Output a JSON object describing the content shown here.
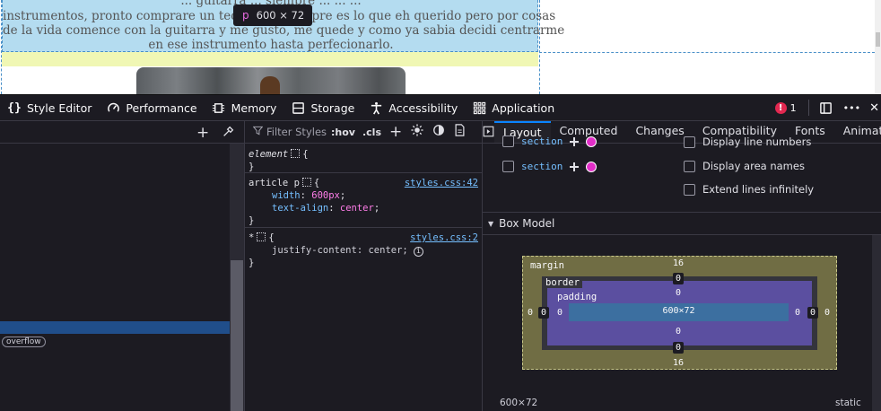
{
  "viewport": {
    "paragraph_lines": [
      "... guitarra ... siempre ... ... ...",
      "instrumentos, pronto comprare un teclado ... siempre es lo que eh querido pero por cosas",
      "de la vida comence con la guitarra y me gusto, me quede y como ya sabia decidi centrarme",
      "en ese instrumento hasta perfecionarlo."
    ],
    "tooltip": {
      "tag": "p",
      "dims": "600 × 72"
    }
  },
  "toolbar": {
    "tools": [
      {
        "label": "Style Editor",
        "icon": "braces-icon"
      },
      {
        "label": "Performance",
        "icon": "gauge-icon"
      },
      {
        "label": "Memory",
        "icon": "chip-icon"
      },
      {
        "label": "Storage",
        "icon": "storage-icon"
      },
      {
        "label": "Accessibility",
        "icon": "accessibility-icon"
      },
      {
        "label": "Application",
        "icon": "grid-icon"
      }
    ],
    "error_count": "1",
    "more_label": "•••",
    "close_label": "✕"
  },
  "markup": {
    "badge": "overflow"
  },
  "rules": {
    "filter_placeholder": "Filter Styles",
    "hov_label": ":hov",
    "cls_label": ".cls",
    "element_selector": "element",
    "element_open": "{",
    "element_close": "}",
    "rule1": {
      "selector": "article p",
      "open": "{",
      "source": "styles.css:42",
      "decls": [
        {
          "prop": "width",
          "value": "600px"
        },
        {
          "prop": "text-align",
          "value": "center"
        }
      ],
      "close": "}"
    },
    "rule2": {
      "selector": "*",
      "open": "{",
      "source": "styles.css:2",
      "decls": [
        {
          "prop": "justify-content",
          "value": "center"
        }
      ],
      "close": "}"
    }
  },
  "layout": {
    "tabs": [
      "Layout",
      "Computed",
      "Changes",
      "Compatibility",
      "Fonts",
      "Animation"
    ],
    "active_tab": "Layout",
    "section_label": "section",
    "options": [
      "Display line numbers",
      "Display area names",
      "Extend lines infinitely"
    ],
    "box_model_title": "Box Model",
    "box": {
      "margin_label": "margin",
      "border_label": "border",
      "padding_label": "padding",
      "margin_top": "16",
      "margin_bottom": "16",
      "margin_left": "0",
      "margin_right": "0",
      "border_top": "0",
      "border_bottom": "0",
      "border_left": "0",
      "border_right": "0",
      "padding_top": "0",
      "padding_bottom": "0",
      "padding_left": "0",
      "padding_right": "0",
      "content": "600×72"
    },
    "size": "600×72",
    "position": "static"
  },
  "colors": {
    "accent": "#0a84ff",
    "error": "#e22850",
    "highlight_blue": "#b4dcf0",
    "margin_yellow": "#f0f7b4"
  }
}
